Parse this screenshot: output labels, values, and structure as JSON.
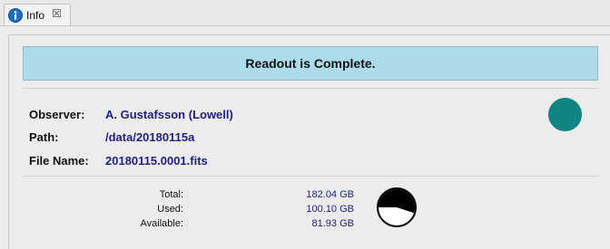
{
  "tab": {
    "label": "Info",
    "icon": "info-icon",
    "close_icon": "close-icon",
    "close_glyph": "☒"
  },
  "banner": {
    "text": "Readout is Complete."
  },
  "fields": [
    {
      "label": "Observer:",
      "value": "A. Gustafsson (Lowell)"
    },
    {
      "label": "Path:",
      "value": "/data/20180115a"
    },
    {
      "label": "File Name:",
      "value": "20180115.0001.fits"
    }
  ],
  "status": {
    "color": "#0f8483"
  },
  "disk": {
    "rows": [
      {
        "label": "Total:",
        "value": "182.04 GB"
      },
      {
        "label": "Used:",
        "value": "100.10 GB"
      },
      {
        "label": "Available:",
        "value": "81.93 GB"
      }
    ],
    "used_fraction": 0.55
  },
  "colors": {
    "banner": "#acdbe9",
    "value_text": "#1f1f80",
    "status_dot": "#0f8483"
  }
}
